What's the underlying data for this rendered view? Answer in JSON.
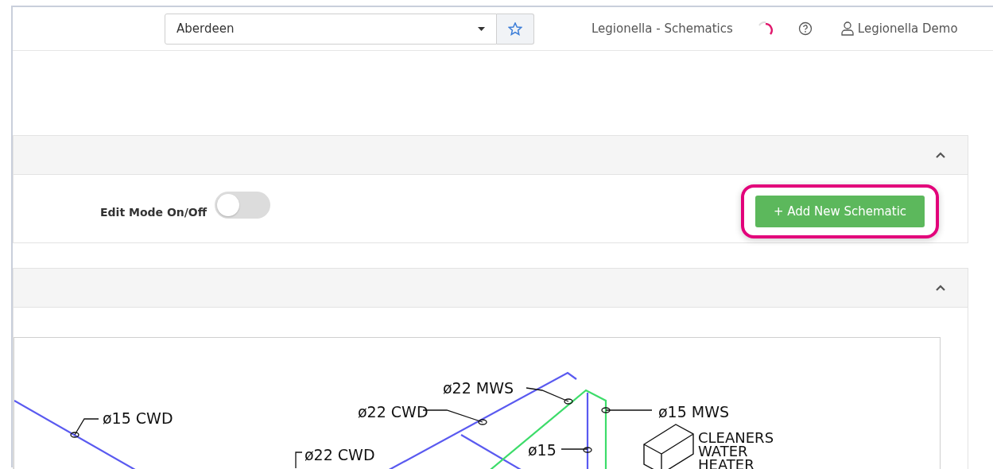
{
  "header": {
    "location_select": {
      "value": "Aberdeen"
    },
    "page_title": "Legionella - Schematics",
    "user_name": "Legionella Demo"
  },
  "panels": [
    {
      "expanded": true,
      "edit_mode": {
        "label": "Edit Mode On/Off",
        "on": false
      },
      "add_button": {
        "label": "+ Add New Schematic",
        "highlighted": true
      }
    },
    {
      "expanded": true
    }
  ],
  "schematic": {
    "labels": [
      "ø15 CWD",
      "ø22 MWS",
      "ø22 CWD",
      "ø15 MWS",
      "ø15",
      "ø22 CWD"
    ],
    "heater_label_lines": [
      "CLEANERS",
      "WATER",
      "HEATER"
    ]
  }
}
